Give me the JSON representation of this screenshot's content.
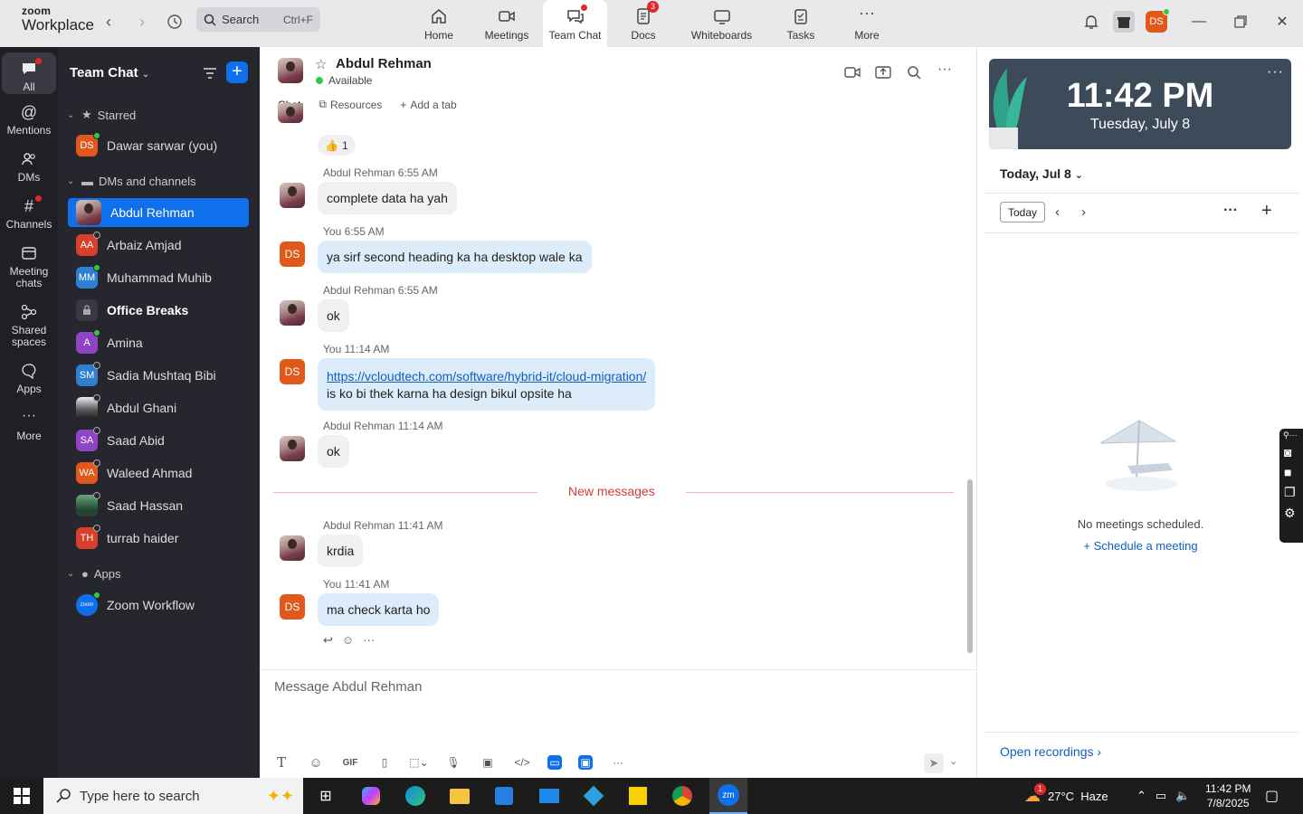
{
  "app": {
    "logo_top": "zoom",
    "logo_bottom": "Workplace"
  },
  "search": {
    "label": "Search",
    "shortcut": "Ctrl+F"
  },
  "tabs": [
    {
      "label": "Home"
    },
    {
      "label": "Meetings"
    },
    {
      "label": "Team Chat"
    },
    {
      "label": "Docs",
      "badge": "3"
    },
    {
      "label": "Whiteboards"
    },
    {
      "label": "Tasks"
    },
    {
      "label": "More"
    }
  ],
  "profile": {
    "initials": "DS"
  },
  "rail": [
    {
      "label": "All"
    },
    {
      "label": "Mentions"
    },
    {
      "label": "DMs"
    },
    {
      "label": "Channels"
    },
    {
      "label": "Meeting chats"
    },
    {
      "label": "Shared spaces"
    },
    {
      "label": "Apps"
    },
    {
      "label": "More"
    }
  ],
  "sidebar": {
    "title": "Team Chat",
    "starred_label": "Starred",
    "dms_label": "DMs and channels",
    "apps_label": "Apps",
    "starred": [
      {
        "initials": "DS",
        "name": "Dawar sarwar (you)",
        "color": "#e0591a"
      }
    ],
    "contacts": [
      {
        "initials": "",
        "name": "Abdul Rehman",
        "color": "#7a3b4b"
      },
      {
        "initials": "AA",
        "name": "Arbaiz Amjad",
        "color": "#d9402b"
      },
      {
        "initials": "MM",
        "name": "Muhammad Muhib",
        "color": "#2f7fd1"
      },
      {
        "initials": "",
        "name": "Office Breaks",
        "color": "#3a3a44"
      },
      {
        "initials": "A",
        "name": "Amina",
        "color": "#8e44c4"
      },
      {
        "initials": "SM",
        "name": "Sadia Mushtaq Bibi",
        "color": "#2f7fd1"
      },
      {
        "initials": "",
        "name": "Abdul Ghani",
        "color": "#555555"
      },
      {
        "initials": "SA",
        "name": "Saad Abid",
        "color": "#8e44c4"
      },
      {
        "initials": "WA",
        "name": "Waleed Ahmad",
        "color": "#e0591a"
      },
      {
        "initials": "",
        "name": "Saad Hassan",
        "color": "#445544"
      },
      {
        "initials": "TH",
        "name": "turrab haider",
        "color": "#d9402b"
      }
    ],
    "apps": [
      {
        "initials": "zoom",
        "name": "Zoom Workflow",
        "color": "#0e71eb"
      }
    ]
  },
  "chat": {
    "contact_name": "Abdul Rehman",
    "status": "Available",
    "tabs": [
      "Chat",
      "Resources",
      "Add a tab"
    ],
    "reaction": "1",
    "messages": [
      {
        "sender": "Abdul Rehman",
        "time": "6:55 AM",
        "lines": [
          "complete data ha yah"
        ]
      },
      {
        "sender": "You",
        "time": "6:55 AM",
        "lines": [
          "ya sirf second heading ka ha desktop wale ka"
        ]
      },
      {
        "sender": "Abdul Rehman",
        "time": "6:55 AM",
        "lines": [
          "ok"
        ]
      },
      {
        "sender": "You",
        "time": "11:14 AM",
        "lines": [
          "https://vcloudtech.com/software/hybrid-it/cloud-migration/",
          "is ko bi thek karna ha design bikul opsite ha"
        ]
      },
      {
        "sender": "Abdul Rehman",
        "time": "11:14 AM",
        "lines": [
          "ok"
        ]
      },
      {
        "sender": "Abdul Rehman",
        "time": "11:41 AM",
        "lines": [
          "krdia"
        ]
      },
      {
        "sender": "You",
        "time": "11:41 AM",
        "lines": [
          "ma check karta ho"
        ]
      }
    ],
    "new_messages_label": "New messages",
    "composer_placeholder": "Message Abdul Rehman",
    "my_initials": "DS"
  },
  "calendar": {
    "time": "11:42 PM",
    "date": "Tuesday, July 8",
    "heading": "Today, Jul 8",
    "today_btn": "Today",
    "empty": "No meetings scheduled.",
    "schedule": "Schedule a meeting",
    "open_recordings": "Open recordings"
  },
  "taskbar": {
    "search_placeholder": "Type here to search",
    "weather": "27°C  Haze",
    "weather_badge": "1",
    "clock_time": "11:42 PM",
    "clock_date": "7/8/2025"
  },
  "colors": {
    "accent": "#0e71eb",
    "sidebar_bg": "#26262e",
    "rail_bg": "#1f1f26",
    "bubble_mine": "#dcecfb",
    "alert": "#e02828"
  }
}
